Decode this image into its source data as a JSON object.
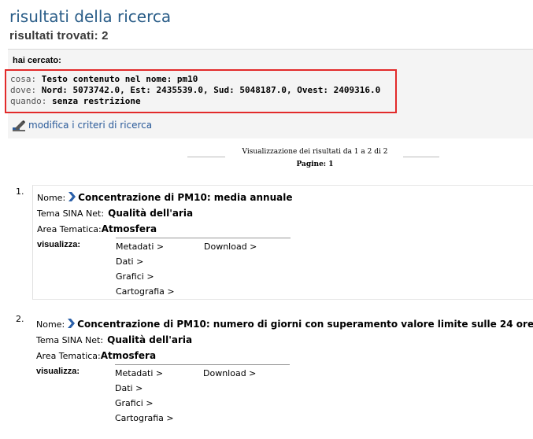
{
  "header": {
    "title": "risultati della ricerca",
    "results_found": "risultati trovati:  2"
  },
  "search": {
    "heading": "hai cercato:",
    "cosa_label": "cosa:",
    "cosa_value": "Testo contenuto nel nome: pm10",
    "dove_label": "dove:",
    "dove_value": "Nord: 5073742.0, Est: 2435539.0, Sud: 5048187.0, Ovest: 2409316.0",
    "quando_label": "quando:",
    "quando_value": "senza restrizione",
    "modify_link": "modifica i criteri di ricerca"
  },
  "paging": {
    "summary": "Visualizzazione dei risultati da 1 a 2 di 2",
    "pages": "Pagine: 1"
  },
  "labels": {
    "nome": "Nome:",
    "tema": "Tema SINA Net:",
    "area": "Area Tematica:",
    "visualizza": "visualizza:",
    "metadati": "Metadati >",
    "download": "Download >",
    "dati": "Dati >",
    "grafici": "Grafici >",
    "cartografia": "Cartografia >"
  },
  "results": [
    {
      "number": "1.",
      "name": "Concentrazione di PM10: media annuale",
      "tema": "Qualità dell'aria",
      "area": "Atmosfera"
    },
    {
      "number": "2.",
      "name": "Concentrazione di PM10: numero di giorni con superamento valore limite sulle 24 ore",
      "tema": "Qualità dell'aria",
      "area": "Atmosfera"
    }
  ]
}
